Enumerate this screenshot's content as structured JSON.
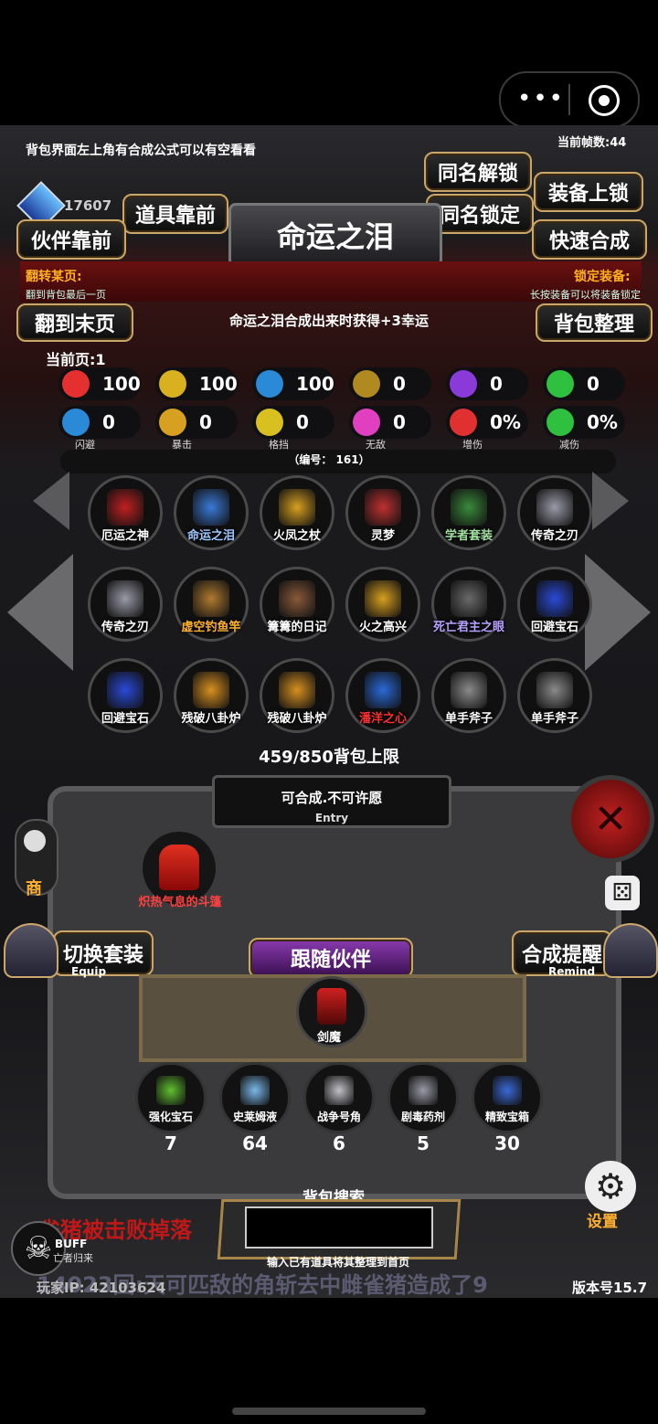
{
  "header": {
    "frames": "当前帧数:44"
  },
  "tip": "背包界面左上角有合成公式可以有空看看",
  "gems": "17607",
  "buttons": {
    "same_unlock": "同名解锁",
    "equip_lock": "装备上锁",
    "item_front": "道具靠前",
    "same_lock": "同名锁定",
    "partner_front": "伙伴靠前",
    "quick_craft": "快速合成",
    "to_last": "翻到末页",
    "sort_bag": "背包整理",
    "switch_set": "切换套装",
    "switch_set_sub": "Equip",
    "craft_remind": "合成提醒",
    "craft_remind_sub": "Remind",
    "follow_partner": "跟随伙伴"
  },
  "selected_item": "命运之泪",
  "flip": {
    "title": "翻转某页:",
    "desc": "翻到背包最后一页"
  },
  "lock": {
    "title": "锁定装备:",
    "desc": "长按装备可以将装备锁定"
  },
  "description": "命运之泪合成出来时获得+3幸运",
  "current_page": "当前页:1",
  "stats": [
    {
      "icon": "heart-icon",
      "value": "100",
      "color": "#e53030"
    },
    {
      "icon": "strength-icon",
      "value": "100",
      "color": "#d8b020"
    },
    {
      "icon": "helmet-icon",
      "value": "100",
      "color": "#2a8ad8"
    },
    {
      "icon": "sword-icon",
      "value": "0",
      "color": "#b08a20"
    },
    {
      "icon": "lightning-icon",
      "value": "0",
      "color": "#8a3ad8"
    },
    {
      "icon": "clover-icon",
      "value": "0",
      "color": "#30c040"
    },
    {
      "icon": "dodge-icon",
      "value": "0",
      "color": "#2a8ad8",
      "caption": "闪避"
    },
    {
      "icon": "crit-icon",
      "value": "0",
      "color": "#d8a020",
      "caption": "暴击"
    },
    {
      "icon": "block-icon",
      "value": "0",
      "color": "#d8c020",
      "caption": "格挡"
    },
    {
      "icon": "invincible-icon",
      "value": "0",
      "color": "#e040c0",
      "caption": "无敌"
    },
    {
      "icon": "damage-up-icon",
      "value": "0%",
      "color": "#e03030",
      "caption": "增伤"
    },
    {
      "icon": "damage-down-icon",
      "value": "0%",
      "color": "#30c040",
      "caption": "减伤"
    }
  ],
  "serial": "（编号： 161）",
  "items": [
    {
      "name": "厄运之神",
      "color": "#ffffff",
      "glow": "#c02020"
    },
    {
      "name": "命运之泪",
      "color": "#9ec8ff",
      "glow": "#3a7ad8"
    },
    {
      "name": "火凤之杖",
      "color": "#ffffff",
      "glow": "#d8a020"
    },
    {
      "name": "灵梦",
      "color": "#ffffff",
      "glow": "#c03030"
    },
    {
      "name": "学者套装",
      "color": "#a0e0a0",
      "glow": "#3a8a3a"
    },
    {
      "name": "传奇之刃",
      "color": "#ffffff",
      "glow": "#9a9aa8"
    },
    {
      "name": "传奇之刃",
      "color": "#ffffff",
      "glow": "#9a9aa8"
    },
    {
      "name": "虚空钓鱼竿",
      "color": "#ffb030",
      "glow": "#b07a30"
    },
    {
      "name": "篝篝的日记",
      "color": "#ffffff",
      "glow": "#8a5a3a"
    },
    {
      "name": "火之高兴",
      "color": "#ffffff",
      "glow": "#d8a020"
    },
    {
      "name": "死亡君主之眼",
      "color": "#b8a0ff",
      "glow": "#6a6a6a"
    },
    {
      "name": "回避宝石",
      "color": "#ffffff",
      "glow": "#2a4ad8"
    },
    {
      "name": "回避宝石",
      "color": "#ffffff",
      "glow": "#2a4ad8"
    },
    {
      "name": "残破八卦炉",
      "color": "#ffffff",
      "glow": "#d89020"
    },
    {
      "name": "残破八卦炉",
      "color": "#ffffff",
      "glow": "#d89020"
    },
    {
      "name": "潘洋之心",
      "color": "#ff3030",
      "glow": "#2a6ad8"
    },
    {
      "name": "单手斧子",
      "color": "#ffffff",
      "glow": "#8a8a8a"
    },
    {
      "name": "单手斧子",
      "color": "#ffffff",
      "glow": "#8a8a8a"
    }
  ],
  "capacity": "459/850背包上限",
  "entry": {
    "status": "可合成.不可许愿",
    "sub": "Entry"
  },
  "cape": "炽热气息的斗篷",
  "partner": "剑魔",
  "materials": [
    {
      "name": "强化宝石",
      "count": "7",
      "glow": "#60c030"
    },
    {
      "name": "史莱姆液",
      "count": "64",
      "glow": "#7ab8e8"
    },
    {
      "name": "战争号角",
      "count": "6",
      "glow": "#c0c0c8"
    },
    {
      "name": "剧毒药剂",
      "count": "5",
      "glow": "#9a9aa8"
    },
    {
      "name": "精致宝箱",
      "count": "30",
      "glow": "#3a6ad8"
    }
  ],
  "search": {
    "label": "背包搜索",
    "placeholder": "",
    "hint": "输入已有道具将其整理到首页"
  },
  "side": {
    "shop": "商",
    "settings": "设置"
  },
  "ticker": {
    "line1": "雀猪被击败掉落",
    "line2": "14023回:天可匹敌的角斩去中雌雀猪造成了9"
  },
  "buff": {
    "label": "BUFF",
    "sub": "亡者归来"
  },
  "footer": {
    "ip": "玩家IP:  42103624",
    "version": "版本号15.7"
  }
}
